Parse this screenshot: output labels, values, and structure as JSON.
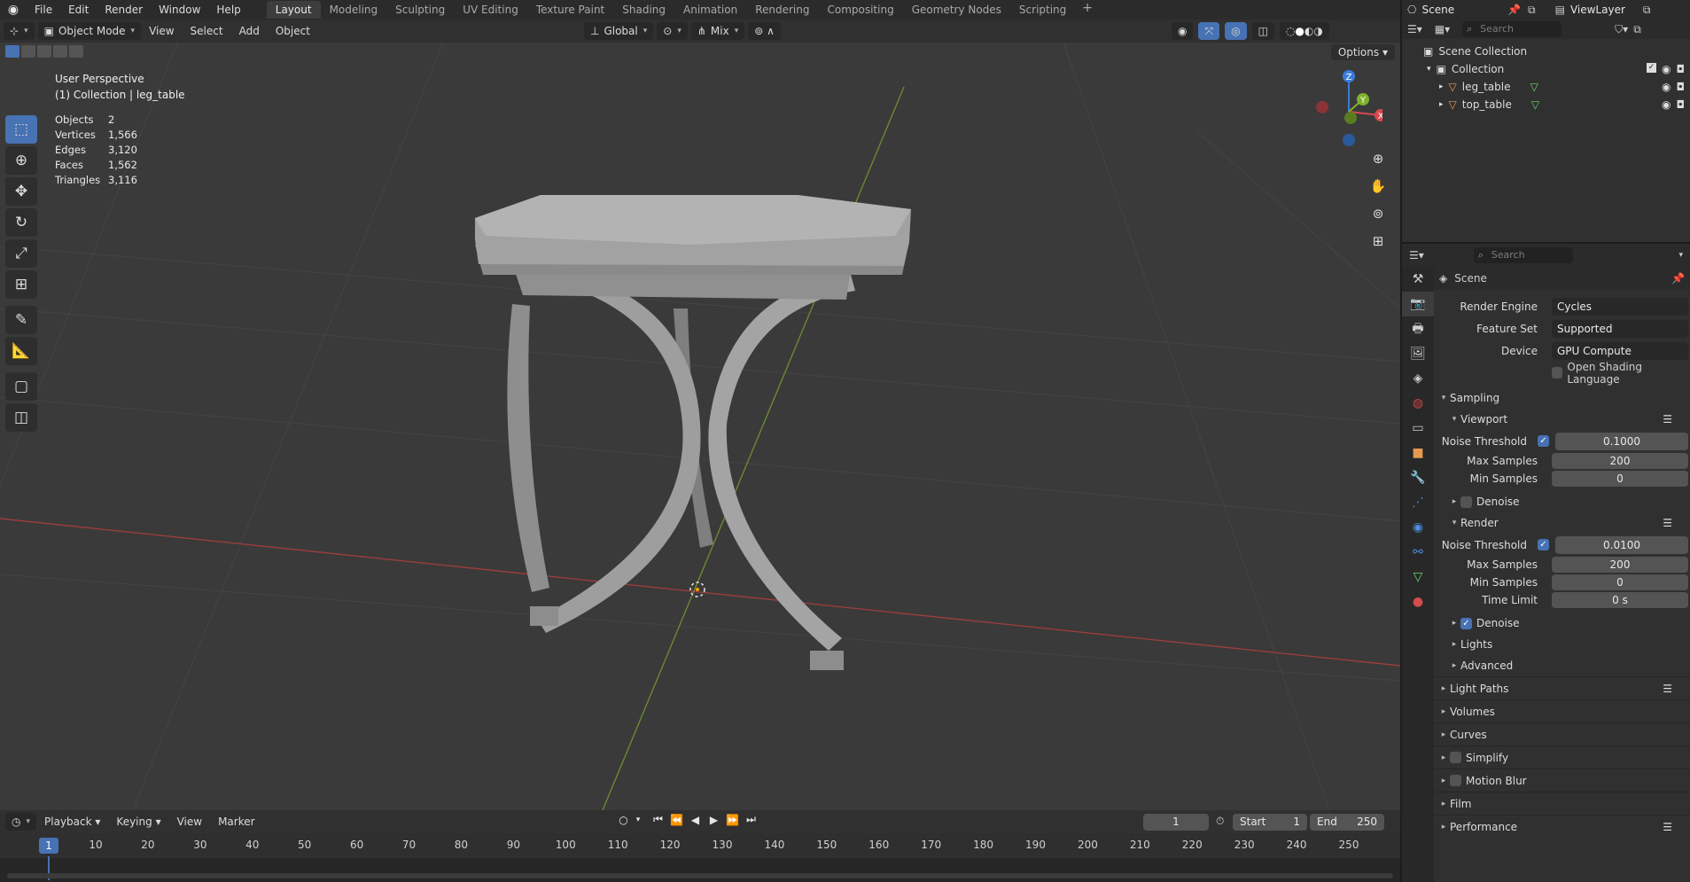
{
  "topbar": {
    "menus": [
      "File",
      "Edit",
      "Render",
      "Window",
      "Help"
    ],
    "workspace_tabs": [
      "Layout",
      "Modeling",
      "Sculpting",
      "UV Editing",
      "Texture Paint",
      "Shading",
      "Animation",
      "Rendering",
      "Compositing",
      "Geometry Nodes",
      "Scripting"
    ],
    "active_tab": "Layout",
    "scene_label": "Scene",
    "viewlayer_label": "ViewLayer"
  },
  "header": {
    "mode": "Object Mode",
    "menus": [
      "View",
      "Select",
      "Add",
      "Object"
    ],
    "orientation": "Global",
    "snap": "Mix",
    "options": "Options"
  },
  "viewport": {
    "perspective": "User Perspective",
    "collection_line": "(1) Collection | leg_table",
    "stats": [
      {
        "k": "Objects",
        "v": "2"
      },
      {
        "k": "Vertices",
        "v": "1,566"
      },
      {
        "k": "Edges",
        "v": "3,120"
      },
      {
        "k": "Faces",
        "v": "1,562"
      },
      {
        "k": "Triangles",
        "v": "3,116"
      }
    ],
    "gizmo": {
      "x": "X",
      "y": "Y",
      "z": "Z"
    }
  },
  "timeline": {
    "menus": [
      "Playback",
      "Keying",
      "View",
      "Marker"
    ],
    "current_frame": "1",
    "start_label": "Start",
    "start": "1",
    "end_label": "End",
    "end": "250",
    "ticks": [
      "1",
      "10",
      "20",
      "30",
      "40",
      "50",
      "60",
      "70",
      "80",
      "90",
      "100",
      "110",
      "120",
      "130",
      "140",
      "150",
      "160",
      "170",
      "180",
      "190",
      "200",
      "210",
      "220",
      "230",
      "240",
      "250"
    ]
  },
  "outliner": {
    "search_placeholder": "Search",
    "scene_collection": "Scene Collection",
    "collection": "Collection",
    "objects": [
      "leg_table",
      "top_table"
    ]
  },
  "properties": {
    "search_placeholder": "Search",
    "context": "Scene",
    "render_engine_label": "Render Engine",
    "render_engine": "Cycles",
    "feature_set_label": "Feature Set",
    "feature_set": "Supported",
    "device_label": "Device",
    "device": "GPU Compute",
    "osl_label": "Open Shading Language",
    "sampling": "Sampling",
    "viewport_sub": "Viewport",
    "vp_noise_label": "Noise Threshold",
    "vp_noise": "0.1000",
    "vp_max_label": "Max Samples",
    "vp_max": "200",
    "vp_min_label": "Min Samples",
    "vp_min": "0",
    "denoise_label": "Denoise",
    "render_sub": "Render",
    "r_noise_label": "Noise Threshold",
    "r_noise": "0.0100",
    "r_max_label": "Max Samples",
    "r_max": "200",
    "r_min_label": "Min Samples",
    "r_min": "0",
    "time_limit_label": "Time Limit",
    "time_limit": "0 s",
    "r_denoise_label": "Denoise",
    "lights": "Lights",
    "advanced": "Advanced",
    "panels": [
      "Light Paths",
      "Volumes",
      "Curves",
      "Simplify",
      "Motion Blur",
      "Film",
      "Performance"
    ]
  }
}
